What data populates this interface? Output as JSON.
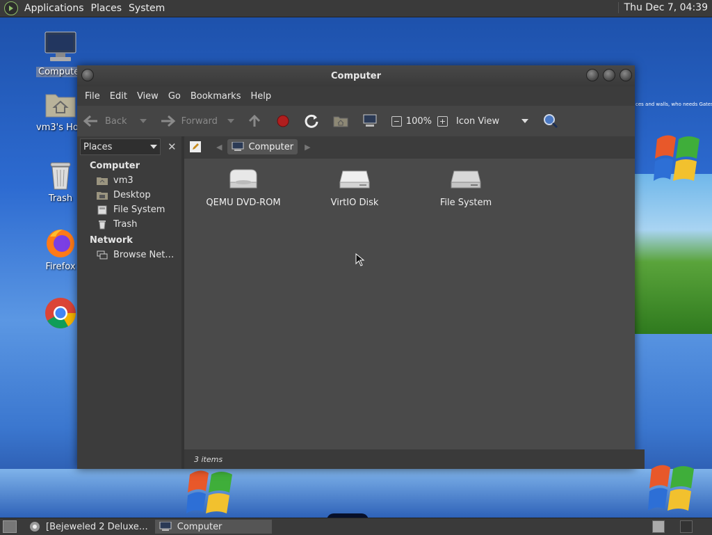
{
  "top_panel": {
    "menus": [
      "Applications",
      "Places",
      "System"
    ],
    "clock": "Thu Dec 7, 04:39"
  },
  "desktop_icons": [
    {
      "label": "Computer",
      "icon": "computer-icon"
    },
    {
      "label": "vm3's Hom",
      "icon": "home-folder-icon"
    },
    {
      "label": "Trash",
      "icon": "trash-icon"
    },
    {
      "label": "Firefox",
      "icon": "firefox-icon"
    },
    {
      "label": "",
      "icon": "chrome-icon"
    }
  ],
  "window": {
    "title": "Computer",
    "menubar": [
      "File",
      "Edit",
      "View",
      "Go",
      "Bookmarks",
      "Help"
    ],
    "toolbar": {
      "back": "Back",
      "forward": "Forward",
      "zoom": "100%",
      "view_mode": "Icon View"
    },
    "sidebar": {
      "selector": "Places",
      "sections": [
        {
          "title": "Computer",
          "items": [
            {
              "label": "vm3",
              "icon": "home-folder-icon"
            },
            {
              "label": "Desktop",
              "icon": "desktop-folder-icon"
            },
            {
              "label": "File System",
              "icon": "drive-icon"
            },
            {
              "label": "Trash",
              "icon": "trash-icon"
            }
          ]
        },
        {
          "title": "Network",
          "items": [
            {
              "label": "Browse Net…",
              "icon": "network-icon"
            }
          ]
        }
      ]
    },
    "path": {
      "current": "Computer"
    },
    "items": [
      {
        "label": "QEMU DVD-ROM",
        "icon": "optical-drive-icon"
      },
      {
        "label": "VirtIO Disk",
        "icon": "hard-disk-icon"
      },
      {
        "label": "File System",
        "icon": "hard-disk-icon"
      }
    ],
    "status": "3 items"
  },
  "taskbar": {
    "tasks": [
      {
        "label": "[Bejeweled 2 Deluxe…",
        "icon": "chrome-icon"
      },
      {
        "label": "Computer",
        "icon": "computer-icon"
      }
    ]
  },
  "wallpaper_text": "ces and walls, who needs Gates a"
}
